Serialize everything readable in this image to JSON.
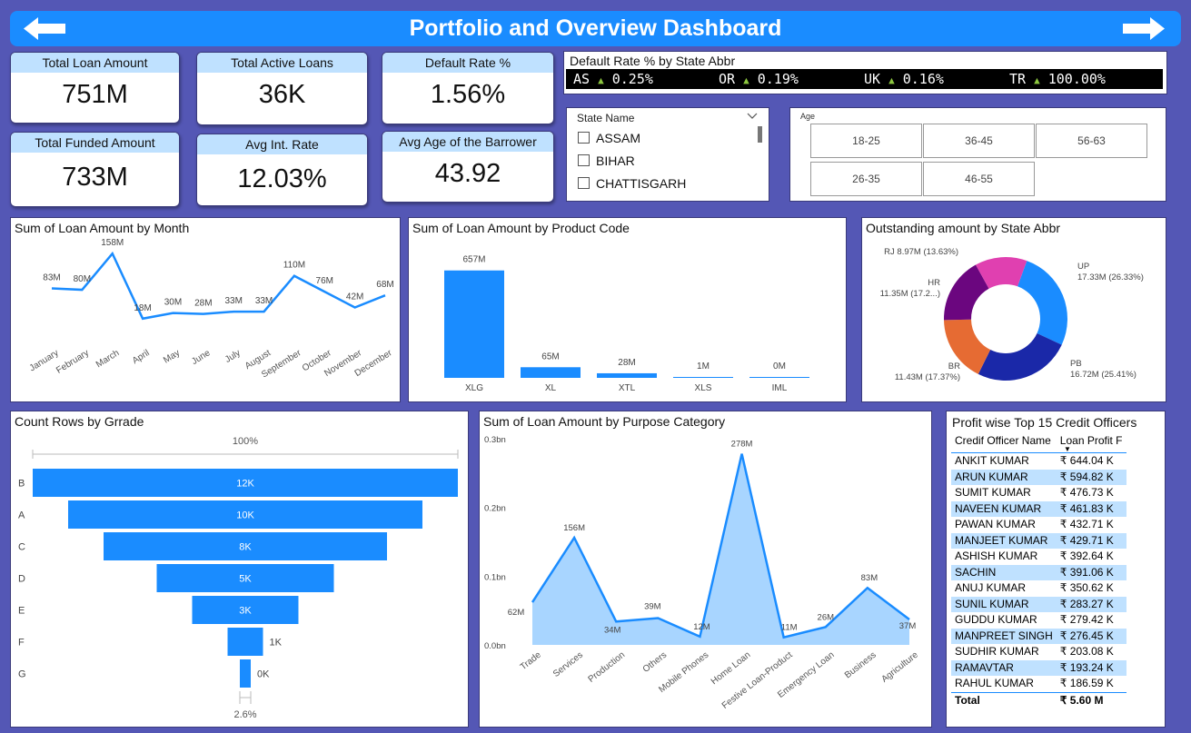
{
  "header": {
    "title": "Portfolio and Overview Dashboard"
  },
  "kpis": [
    {
      "label": "Total Loan Amount",
      "value": "751M"
    },
    {
      "label": "Total Active Loans",
      "value": "36K"
    },
    {
      "label": "Default Rate %",
      "value": "1.56%"
    },
    {
      "label": "Total Funded Amount",
      "value": "733M"
    },
    {
      "label": "Avg Int. Rate",
      "value": "12.03%"
    },
    {
      "label": "Avg Age of the Barrower",
      "value": "43.92"
    }
  ],
  "default_rate_ticker": {
    "title": "Default Rate % by State Abbr",
    "items": [
      {
        "state": "AS",
        "value": "0.25%"
      },
      {
        "state": "OR",
        "value": "0.19%"
      },
      {
        "state": "UK",
        "value": "0.16%"
      },
      {
        "state": "TR",
        "value": "100.00%"
      }
    ],
    "up_color": "#8cc63f"
  },
  "state_slicer": {
    "title": "State Name",
    "options": [
      "ASSAM",
      "BIHAR",
      "CHATTISGARH"
    ]
  },
  "age_slicer": {
    "title": "Age",
    "buttons": [
      "18-25",
      "36-45",
      "56-63",
      "26-35",
      "46-55"
    ]
  },
  "officers": {
    "title": "Profit wise Top 15 Credit Officers",
    "col1": "Credif Officer Name",
    "col2": "Loan Profit F",
    "rows": [
      {
        "name": "ANKIT KUMAR",
        "profit": "₹ 644.04 K"
      },
      {
        "name": "ARUN KUMAR",
        "profit": "₹ 594.82 K"
      },
      {
        "name": "SUMIT KUMAR",
        "profit": "₹ 476.73 K"
      },
      {
        "name": "NAVEEN KUMAR",
        "profit": "₹ 461.83 K"
      },
      {
        "name": "PAWAN KUMAR",
        "profit": "₹ 432.71 K"
      },
      {
        "name": "MANJEET KUMAR",
        "profit": "₹ 429.71 K"
      },
      {
        "name": "ASHISH KUMAR",
        "profit": "₹ 392.64 K"
      },
      {
        "name": "SACHIN",
        "profit": "₹ 391.06 K"
      },
      {
        "name": "ANUJ KUMAR",
        "profit": "₹ 350.62 K"
      },
      {
        "name": "SUNIL KUMAR",
        "profit": "₹ 283.27 K"
      },
      {
        "name": "GUDDU KUMAR",
        "profit": "₹ 279.42 K"
      },
      {
        "name": "MANPREET SINGH",
        "profit": "₹ 276.45 K"
      },
      {
        "name": "SUDHIR KUMAR",
        "profit": "₹ 203.08 K"
      },
      {
        "name": "RAMAVTAR",
        "profit": "₹ 193.24 K"
      },
      {
        "name": "RAHUL KUMAR",
        "profit": "₹ 186.59 K"
      }
    ],
    "total_label": "Total",
    "total_value": "₹ 5.60 M"
  },
  "colors": {
    "accent": "#1a8cff",
    "light_accent": "#bfe1ff",
    "background": "#5457b5"
  },
  "chart_data": [
    {
      "id": "month",
      "type": "line",
      "title": "Sum of Loan Amount by Month",
      "categories": [
        "January",
        "February",
        "March",
        "April",
        "May",
        "June",
        "July",
        "August",
        "September",
        "October",
        "November",
        "December"
      ],
      "values": [
        83,
        80,
        158,
        18,
        30,
        28,
        33,
        33,
        110,
        76,
        42,
        68
      ],
      "labels": [
        "83M",
        "80M",
        "158M",
        "18M",
        "30M",
        "28M",
        "33M",
        "33M",
        "110M",
        "76M",
        "42M",
        "68M"
      ],
      "ylim": [
        0,
        170
      ]
    },
    {
      "id": "product",
      "type": "bar",
      "title": "Sum of Loan Amount by Product Code",
      "categories": [
        "XLG",
        "XL",
        "XTL",
        "XLS",
        "IML"
      ],
      "values": [
        657,
        65,
        28,
        1,
        0
      ],
      "labels": [
        "657M",
        "65M",
        "28M",
        "1M",
        "0M"
      ],
      "ylim": [
        0,
        700
      ]
    },
    {
      "id": "outstanding",
      "type": "pie",
      "title": "Outstanding amount by State Abbr",
      "slices": [
        {
          "name": "UP",
          "value": 17.33,
          "label": "17.33M (26.33%)",
          "color": "#1a8cff"
        },
        {
          "name": "PB",
          "value": 16.72,
          "label": "16.72M (25.41%)",
          "color": "#1a28a8"
        },
        {
          "name": "BR",
          "value": 11.43,
          "label": "11.43M (17.37%)",
          "color": "#e66b33"
        },
        {
          "name": "HR",
          "value": 11.35,
          "label": "11.35M (17.2...)",
          "color": "#6b067f"
        },
        {
          "name": "RJ",
          "value": 8.97,
          "label": "8.97M (13.63%)",
          "color": "#e040b0"
        }
      ]
    },
    {
      "id": "grade",
      "type": "bar",
      "title": "Count Rows by Grrade",
      "categories": [
        "B",
        "A",
        "C",
        "D",
        "E",
        "F",
        "G"
      ],
      "values": [
        12,
        10,
        8,
        5,
        3,
        1,
        0.3
      ],
      "labels": [
        "12K",
        "10K",
        "8K",
        "5K",
        "3K",
        "1K",
        "0K"
      ],
      "top_label": "100%",
      "bottom_label": "2.6%"
    },
    {
      "id": "purpose",
      "type": "area",
      "title": "Sum of Loan Amount by Purpose Category",
      "categories": [
        "Trade",
        "Services",
        "Production",
        "Others",
        "Mobile Phones",
        "Home Loan",
        "Festive Loan-Product",
        "Emergency Loan",
        "Business",
        "Agriculture"
      ],
      "values": [
        62,
        156,
        34,
        39,
        12,
        278,
        11,
        26,
        83,
        37
      ],
      "labels": [
        "62M",
        "156M",
        "34M",
        "39M",
        "12M",
        "278M",
        "11M",
        "26M",
        "83M",
        "37M"
      ],
      "yticks": [
        "0.0bn",
        "0.1bn",
        "0.2bn",
        "0.3bn"
      ],
      "ylim": [
        0,
        300
      ]
    }
  ]
}
